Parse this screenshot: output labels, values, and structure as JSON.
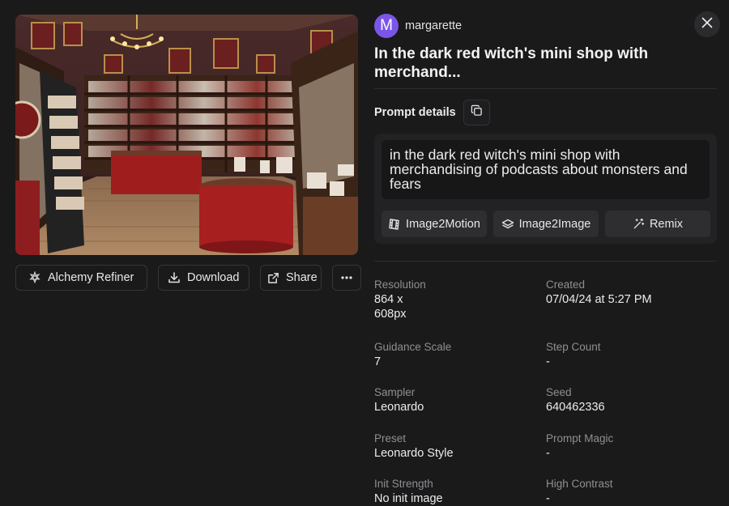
{
  "author": {
    "initial": "M",
    "name": "margarette"
  },
  "title": "In the dark red witch's mini shop with merchand...",
  "prompt": {
    "section_label": "Prompt details",
    "text": "in the dark red witch's mini shop with merchandising of podcasts about monsters and fears"
  },
  "tools": {
    "image2motion": "Image2Motion",
    "image2image": "Image2Image",
    "remix": "Remix"
  },
  "actions": {
    "alchemy_refiner": "Alchemy Refiner",
    "download": "Download",
    "share": "Share"
  },
  "details": {
    "resolution": {
      "label": "Resolution",
      "value_line1": "864 x",
      "value_line2": "608px"
    },
    "created": {
      "label": "Created",
      "value": "07/04/24 at 5:27 PM"
    },
    "guidance_scale": {
      "label": "Guidance Scale",
      "value": "7"
    },
    "step_count": {
      "label": "Step Count",
      "value": "-"
    },
    "sampler": {
      "label": "Sampler",
      "value": "Leonardo"
    },
    "seed": {
      "label": "Seed",
      "value": "640462336"
    },
    "preset": {
      "label": "Preset",
      "value": "Leonardo Style"
    },
    "prompt_magic": {
      "label": "Prompt Magic",
      "value": "-"
    },
    "init_strength": {
      "label": "Init Strength",
      "value": "No init image"
    },
    "high_contrast": {
      "label": "High Contrast",
      "value": "-"
    }
  },
  "icons": {
    "alchemy": "alchemy-icon",
    "download": "download-icon",
    "share": "share-icon",
    "more": "more-icon",
    "close": "close-icon",
    "copy": "copy-icon",
    "motion": "film-icon",
    "i2i": "layers-icon",
    "remix": "magic-wand-icon"
  },
  "colors": {
    "background": "#1a1a1b",
    "panel": "#222224",
    "avatar": "#7b55e8",
    "muted_text": "#8f8f94"
  }
}
